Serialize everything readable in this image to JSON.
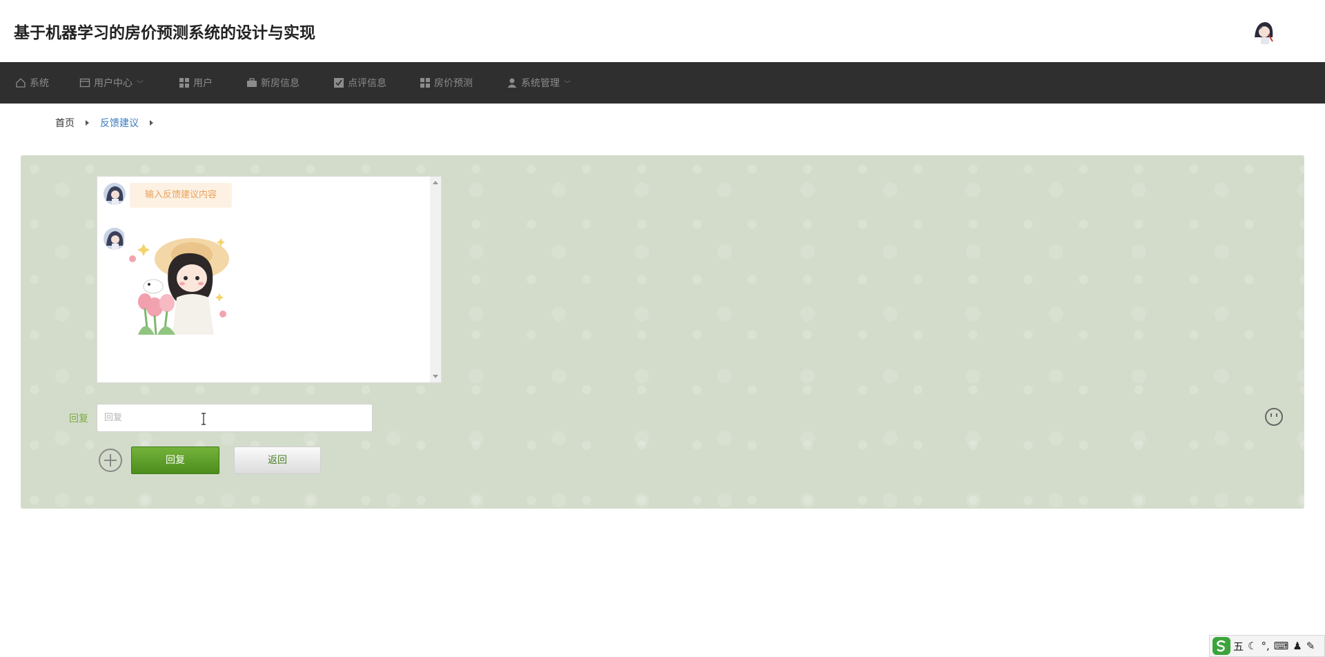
{
  "header": {
    "title": "基于机器学习的房价预测系统的设计与实现",
    "avatar_icon": "user-avatar"
  },
  "nav": {
    "items": [
      {
        "label": "系统",
        "icon": "home-icon"
      },
      {
        "label": "用户中心",
        "icon": "calendar-icon",
        "dropdown": true
      },
      {
        "label": "用户",
        "icon": "grid-icon"
      },
      {
        "label": "新房信息",
        "icon": "briefcase-icon"
      },
      {
        "label": "点评信息",
        "icon": "checkbox-icon"
      },
      {
        "label": "房价预测",
        "icon": "grid-icon"
      },
      {
        "label": "系统管理",
        "icon": "person-icon",
        "dropdown": true
      }
    ]
  },
  "breadcrumb": {
    "home": "首页",
    "current": "反馈建议"
  },
  "chat": {
    "messages": [
      {
        "type": "text",
        "text": "输入反馈建议内容"
      },
      {
        "type": "image",
        "image": "cartoon-girl-sticker"
      }
    ]
  },
  "reply": {
    "label": "回复",
    "placeholder": "回复",
    "value": ""
  },
  "buttons": {
    "reply": "回复",
    "back": "返回"
  },
  "ime": {
    "mode": "五"
  },
  "colors": {
    "nav_bg": "#2f2f2f",
    "panel_bg": "#d3dccb",
    "accent_green": "#5a9a28",
    "link_blue": "#3a7bbf",
    "bubble_bg": "#fdf1e3",
    "bubble_text": "#e8a15c"
  }
}
